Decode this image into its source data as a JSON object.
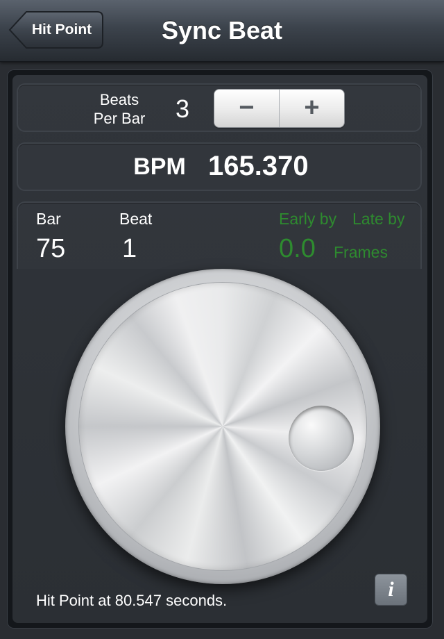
{
  "nav": {
    "back_label": "Hit Point",
    "title": "Sync Beat"
  },
  "beats": {
    "label_line1": "Beats",
    "label_line2": "Per Bar",
    "value": "3",
    "minus_label": "−",
    "plus_label": "+"
  },
  "bpm": {
    "label": "BPM",
    "value": "165.370"
  },
  "position": {
    "bar_label": "Bar",
    "bar_value": "75",
    "beat_label": "Beat",
    "beat_value": "1",
    "early_label": "Early by",
    "late_label": "Late by",
    "offset_value": "0.0",
    "frames_label": "Frames"
  },
  "footer": {
    "hit_point_text": "Hit Point at 80.547 seconds.",
    "info_label": "i"
  },
  "colors": {
    "accent_green": "#2e8b2f",
    "text": "#ffffff",
    "background": "#2a2d32"
  },
  "icons": {
    "back": "chevron-left-icon",
    "info": "info-icon"
  }
}
